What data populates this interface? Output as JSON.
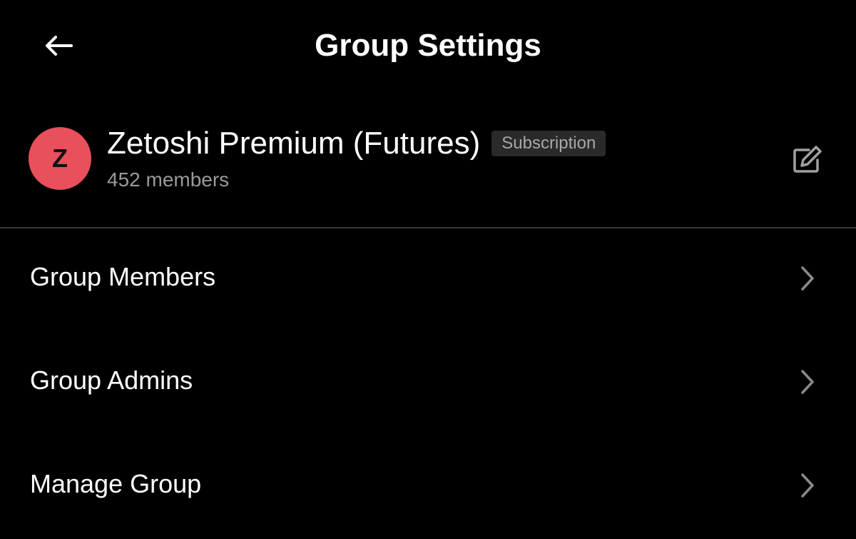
{
  "header": {
    "title": "Group Settings",
    "back_icon": "arrow-left-icon"
  },
  "group": {
    "avatar_letter": "Z",
    "avatar_color": "#e8505b",
    "name": "Zetoshi Premium (Futures)",
    "badge": "Subscription",
    "badge_bg": "#2a2a2a",
    "badge_color": "#a8a8a8",
    "member_count": "452 members",
    "edit_icon": "edit-icon"
  },
  "menu": {
    "items": [
      {
        "label": "Group Members",
        "icon": "chevron-right-icon"
      },
      {
        "label": "Group Admins",
        "icon": "chevron-right-icon"
      },
      {
        "label": "Manage Group",
        "icon": "chevron-right-icon"
      }
    ]
  }
}
